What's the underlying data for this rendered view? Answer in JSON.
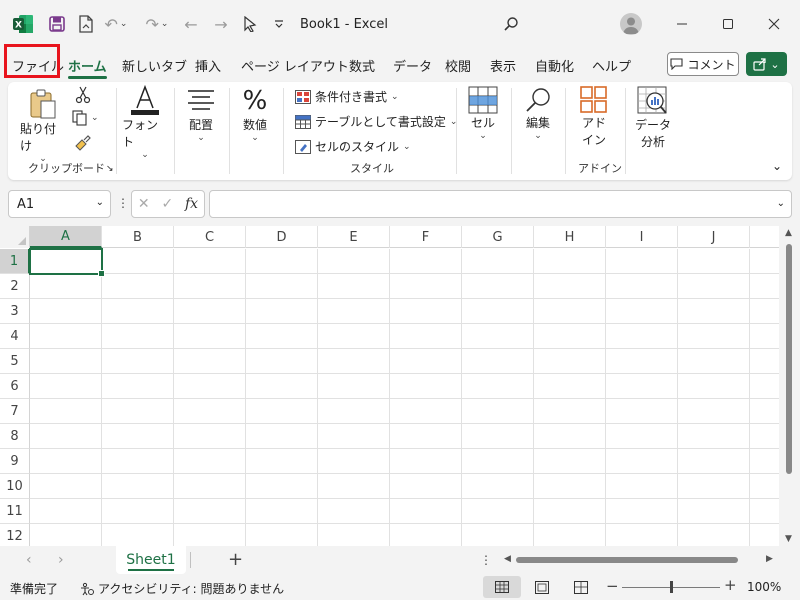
{
  "titlebar": {
    "doc_title": "Book1  -  Excel"
  },
  "tabs": [
    "ファイル",
    "ホーム",
    "新しいタブ",
    "挿入",
    "ページ レイアウト",
    "数式",
    "データ",
    "校閲",
    "表示",
    "自動化",
    "ヘルプ"
  ],
  "active_tab": "ホーム",
  "comment_label": "コメント",
  "ribbon": {
    "paste_label": "貼り付け",
    "clipboard_group": "クリップボード",
    "font_label": "フォント",
    "alignment_label": "配置",
    "number_label": "数値",
    "conditional_format": "条件付き書式",
    "format_as_table": "テーブルとして書式設定",
    "cell_styles": "セルのスタイル",
    "styles_group": "スタイル",
    "cells_label": "セル",
    "editing_label": "編集",
    "addins_label_1": "アド",
    "addins_label_2": "イン",
    "addins_group": "アドイン",
    "analyze_label_1": "データ",
    "analyze_label_2": "分析"
  },
  "formula_bar": {
    "name_box": "A1",
    "fx": "fx",
    "formula": ""
  },
  "columns": [
    "A",
    "B",
    "C",
    "D",
    "E",
    "F",
    "G",
    "H",
    "I",
    "J"
  ],
  "rows": [
    "1",
    "2",
    "3",
    "4",
    "5",
    "6",
    "7",
    "8",
    "9",
    "10",
    "11",
    "12"
  ],
  "active_cell": "A1",
  "sheet_tab": "Sheet1",
  "status": {
    "ready": "準備完了",
    "accessibility": "アクセシビリティ: 問題ありません",
    "zoom": "100%"
  },
  "colors": {
    "accent": "#1e7145",
    "highlight_box": "#e8141d"
  }
}
